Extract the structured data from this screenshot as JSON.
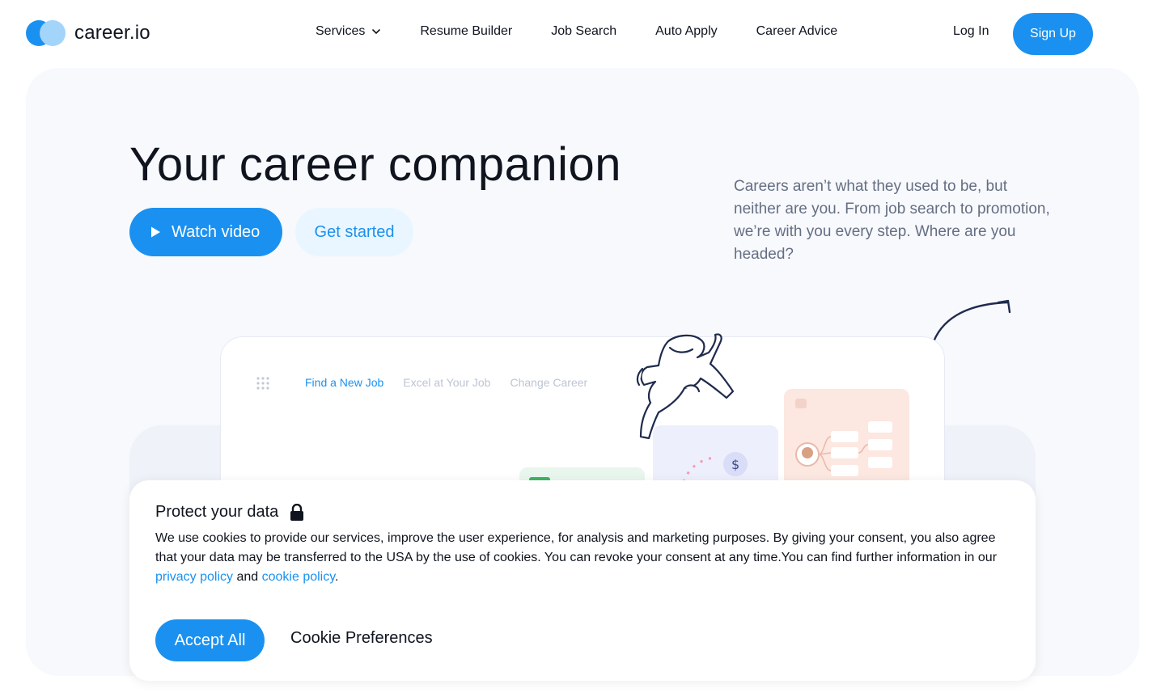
{
  "brand": {
    "name": "career.io"
  },
  "nav": {
    "items": [
      {
        "label": "Services",
        "has_dropdown": true
      },
      {
        "label": "Resume Builder"
      },
      {
        "label": "Job Search"
      },
      {
        "label": "Auto Apply"
      },
      {
        "label": "Career Advice"
      }
    ],
    "login_label": "Log In",
    "signup_label": "Sign Up"
  },
  "hero": {
    "title": "Your career companion",
    "watch_label": "Watch video",
    "start_label": "Get started",
    "description": "Careers aren’t what they used to be, but neither are you. From job search to promotion, we’re with you every step. Where are you headed?"
  },
  "app_preview": {
    "tabs": [
      {
        "label": "Find a New Job",
        "active": true
      },
      {
        "label": "Excel at Your Job",
        "active": false
      },
      {
        "label": "Change Career",
        "active": false
      }
    ]
  },
  "cookie": {
    "title": "Protect your data",
    "text_before": "We use cookies to provide our services, improve the user experience, for analysis and marketing purposes. By giving your consent, you also agree that your data may be transferred to the USA by the use of cookies. You can revoke your consent at any time.You can find further information in our ",
    "privacy_link": "privacy policy",
    "text_mid": " and ",
    "cookie_link": "cookie policy",
    "text_after": ".",
    "accept_label": "Accept All",
    "prefs_label": "Cookie Preferences"
  },
  "colors": {
    "accent": "#1a91f0",
    "accent_light": "#eaf6ff",
    "text": "#0f141e",
    "muted": "#656e83"
  }
}
